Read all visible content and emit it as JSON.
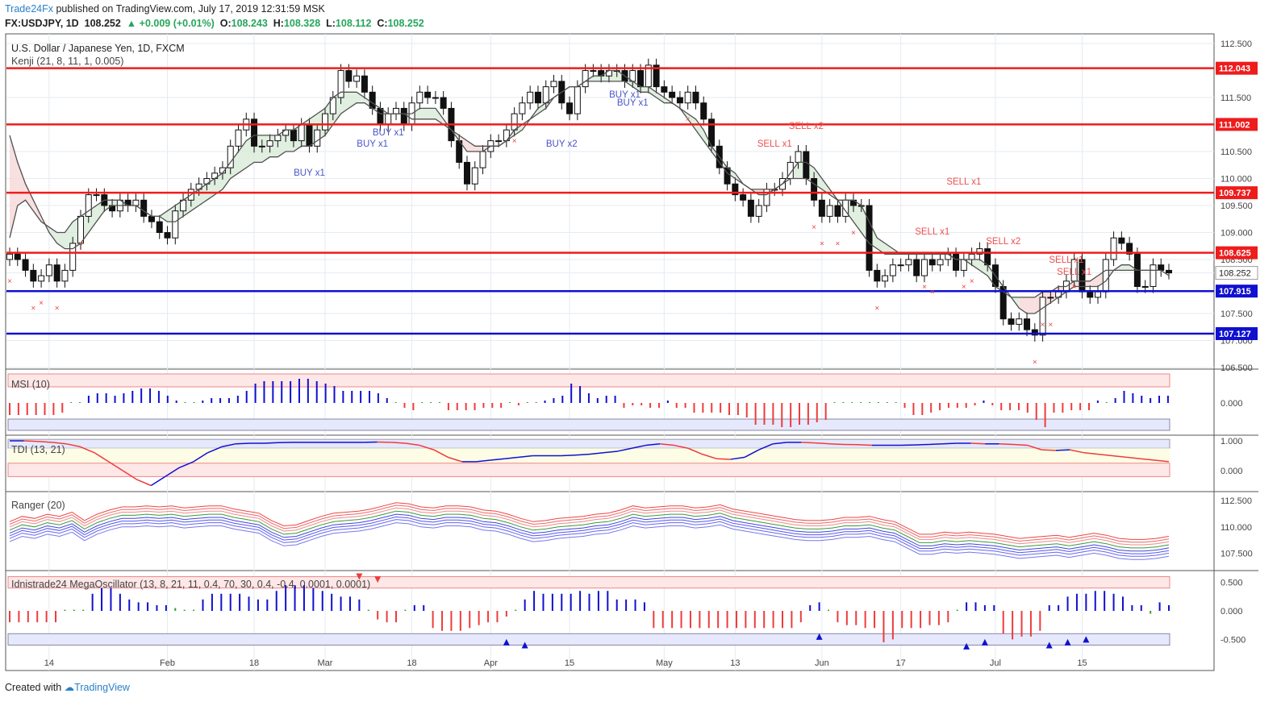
{
  "header": {
    "brand": "Trade24Fx",
    "published": " published on TradingView.com, July 17, 2019 12:31:59 MSK",
    "symbol": "FX:USDJPY, 1D",
    "last": "108.252",
    "change": "+0.009 (+0.01%)",
    "o_label": "O:",
    "o": "108.243",
    "h_label": "H:",
    "h": "108.328",
    "l_label": "L:",
    "l": "108.112",
    "c_label": "C:",
    "c": "108.252"
  },
  "footer": {
    "created": "Created with",
    "logo": "TradingView"
  },
  "colors": {
    "up": "#26a65b",
    "down": "#ef3b3b",
    "support": "#1010d0",
    "resistance": "#ee1c1c",
    "buy": "#4a55c8",
    "sell": "#ee5050",
    "line_green": "#3b9a3b"
  },
  "chart_data": [
    {
      "type": "line",
      "title": "U.S. Dollar / Japanese Yen, 1D, FXCM",
      "indicator": "Kenji (21, 8, 11, 1, 0.005)",
      "x_ticks": [
        "14",
        "Feb",
        "18",
        "Mar",
        "18",
        "Apr",
        "15",
        "May",
        "13",
        "Jun",
        "17",
        "Jul",
        "15"
      ],
      "y_ticks": [
        "112.500",
        "111.500",
        "110.500",
        "110.000",
        "109.500",
        "109.000",
        "108.500",
        "108.252",
        "107.500",
        "107.000",
        "106.500"
      ],
      "ylim": [
        106.5,
        112.65
      ],
      "horizontal_levels": [
        {
          "value": 112.043,
          "label": "112.043",
          "kind": "resistance"
        },
        {
          "value": 111.002,
          "label": "111.002",
          "kind": "resistance"
        },
        {
          "value": 109.737,
          "label": "109.737",
          "kind": "resistance"
        },
        {
          "value": 108.625,
          "label": "108.625",
          "kind": "resistance"
        },
        {
          "value": 107.915,
          "label": "107.915",
          "kind": "support"
        },
        {
          "value": 107.127,
          "label": "107.127",
          "kind": "support"
        }
      ],
      "last_price": {
        "value": 108.252,
        "label": "108.252"
      },
      "close": [
        108.6,
        108.5,
        108.3,
        108.1,
        108.2,
        108.4,
        108.1,
        108.3,
        108.8,
        109.3,
        109.7,
        109.7,
        109.5,
        109.4,
        109.6,
        109.5,
        109.6,
        109.3,
        109.2,
        109.0,
        108.9,
        109.4,
        109.6,
        109.8,
        109.9,
        110.0,
        110.1,
        110.2,
        110.6,
        110.9,
        111.1,
        110.6,
        110.6,
        110.7,
        110.8,
        110.9,
        110.7,
        111.0,
        110.6,
        110.9,
        111.2,
        111.5,
        112.0,
        111.8,
        111.9,
        111.6,
        111.3,
        111.0,
        111.2,
        111.3,
        111.0,
        111.4,
        111.6,
        111.5,
        111.5,
        111.3,
        110.7,
        110.3,
        109.9,
        110.2,
        110.5,
        110.7,
        110.7,
        110.9,
        111.2,
        111.4,
        111.6,
        111.4,
        111.7,
        111.8,
        111.4,
        111.2,
        111.7,
        112.0,
        112.0,
        111.9,
        112.0,
        112.0,
        111.8,
        112.0,
        111.7,
        112.1,
        111.7,
        111.6,
        111.5,
        111.4,
        111.6,
        111.4,
        111.1,
        110.6,
        110.2,
        109.9,
        109.7,
        109.6,
        109.3,
        109.5,
        109.8,
        109.8,
        110.0,
        110.3,
        110.5,
        110.0,
        109.6,
        109.3,
        109.5,
        109.3,
        109.6,
        109.5,
        109.5,
        108.3,
        108.1,
        108.2,
        108.4,
        108.4,
        108.5,
        108.2,
        108.5,
        108.4,
        108.5,
        108.6,
        108.3,
        108.5,
        108.6,
        108.7,
        108.4,
        108.0,
        107.4,
        107.3,
        107.4,
        107.2,
        107.1,
        107.8,
        107.8,
        107.9,
        108.1,
        108.5,
        107.9,
        107.8,
        107.9,
        108.5,
        108.9,
        108.8,
        108.6,
        108.0,
        108.0,
        108.4,
        108.3,
        108.252
      ],
      "series": [
        {
          "kind": "kenji_fast",
          "values": [
            108.9,
            109.5,
            109.6,
            109.4,
            109.2,
            109.1,
            109.0,
            109.0,
            109.2,
            109.3,
            109.4,
            109.5,
            109.6,
            109.6,
            109.6,
            109.5,
            109.5,
            109.4,
            109.3,
            109.3,
            109.4,
            109.5,
            109.6,
            109.7,
            109.8,
            109.9,
            110.0,
            110.1,
            110.3,
            110.5,
            110.7,
            110.8,
            110.8,
            110.8,
            110.8,
            110.9,
            110.9,
            111.0,
            111.1,
            111.2,
            111.3,
            111.5,
            111.6,
            111.6,
            111.6,
            111.5,
            111.4,
            111.3,
            111.2,
            111.2,
            111.2,
            111.2,
            111.3,
            111.3,
            111.3,
            111.1,
            110.9,
            110.7,
            110.5,
            110.5,
            110.5,
            110.6,
            110.6,
            110.7,
            110.9,
            111.0,
            111.1,
            111.3,
            111.4,
            111.5,
            111.6,
            111.7,
            111.7,
            111.8,
            111.9,
            111.9,
            112.0,
            112.0,
            111.9,
            111.8,
            111.7,
            111.7,
            111.6,
            111.5,
            111.4,
            111.3,
            111.2,
            111.1,
            110.9,
            110.6,
            110.4,
            110.2,
            110.1,
            109.9,
            109.8,
            109.7,
            109.7,
            109.8,
            109.9,
            110.1,
            110.3,
            110.3,
            110.2,
            110.0,
            109.8,
            109.6,
            109.6,
            109.6,
            109.5,
            109.2,
            108.9,
            108.8,
            108.7,
            108.6,
            108.6,
            108.6,
            108.6,
            108.6,
            108.6,
            108.6,
            108.5,
            108.5,
            108.5,
            108.5,
            108.4,
            108.2,
            108.0,
            107.8,
            107.6,
            107.5,
            107.5,
            107.6,
            107.7,
            107.8,
            107.9,
            108.0,
            108.0,
            108.0,
            108.0,
            108.1,
            108.3,
            108.4,
            108.4,
            108.3,
            108.3,
            108.3,
            108.3,
            108.2
          ]
        },
        {
          "kind": "kenji_slow",
          "values": [
            110.8,
            110.3,
            109.9,
            109.6,
            109.3,
            109.0,
            108.8,
            108.7,
            108.7,
            108.8,
            109.0,
            109.2,
            109.4,
            109.5,
            109.5,
            109.5,
            109.5,
            109.4,
            109.3,
            109.3,
            109.2,
            109.2,
            109.3,
            109.4,
            109.5,
            109.6,
            109.7,
            109.8,
            110.0,
            110.1,
            110.2,
            110.3,
            110.3,
            110.4,
            110.4,
            110.5,
            110.5,
            110.6,
            110.6,
            110.7,
            110.8,
            111.0,
            111.2,
            111.3,
            111.4,
            111.4,
            111.3,
            111.2,
            111.2,
            111.2,
            111.2,
            111.1,
            111.1,
            111.1,
            111.1,
            111.0,
            110.9,
            110.8,
            110.7,
            110.6,
            110.6,
            110.6,
            110.6,
            110.7,
            110.8,
            110.9,
            111.1,
            111.2,
            111.3,
            111.5,
            111.6,
            111.7,
            111.7,
            111.8,
            111.8,
            111.8,
            111.8,
            111.8,
            111.8,
            111.7,
            111.6,
            111.6,
            111.5,
            111.4,
            111.4,
            111.3,
            111.1,
            110.9,
            110.7,
            110.5,
            110.3,
            110.1,
            110.0,
            109.9,
            109.8,
            109.8,
            109.8,
            109.8,
            109.9,
            110.0,
            110.0,
            110.0,
            109.9,
            109.8,
            109.7,
            109.6,
            109.4,
            109.2,
            109.0,
            108.8,
            108.7,
            108.6,
            108.6,
            108.6,
            108.6,
            108.6,
            108.6,
            108.6,
            108.6,
            108.6,
            108.5,
            108.5,
            108.4,
            108.3,
            108.2,
            108.0,
            107.9,
            107.8,
            107.8,
            107.8,
            107.8,
            107.9,
            107.9,
            108.0,
            108.0,
            108.1,
            108.1,
            108.1,
            108.2,
            108.3,
            108.3,
            108.3,
            108.3,
            108.3,
            108.3,
            108.3
          ]
        }
      ],
      "annotations": [
        "SELL x2",
        "SELL x1",
        "SELL x1",
        "SELL x1",
        "SELL x2",
        "SELL x1",
        "SELL x1",
        "BUY x1",
        "BUY x1",
        "BUY x1",
        "BUY x2",
        "BUY x1",
        "BUY x1"
      ]
    },
    {
      "type": "bar",
      "title": "MSI (10)",
      "y_ticks": [
        "0.000"
      ],
      "values": [
        -0.5,
        -0.5,
        -0.5,
        -0.5,
        -0.5,
        -0.5,
        -0.4,
        0,
        0,
        0.3,
        0.4,
        0.4,
        0.3,
        0.4,
        0.5,
        0.6,
        0.6,
        0.5,
        0.3,
        0.1,
        0,
        0,
        0.1,
        0.2,
        0.2,
        0.2,
        0.3,
        0.5,
        0.8,
        0.9,
        0.9,
        0.9,
        0.9,
        1.0,
        1.0,
        0.9,
        0.8,
        0.7,
        0.5,
        0.5,
        0.5,
        0.5,
        0.4,
        0.2,
        0,
        -0.2,
        -0.3,
        0,
        0,
        0,
        -0.3,
        -0.3,
        -0.3,
        -0.3,
        -0.2,
        -0.2,
        -0.2,
        0,
        -0.1,
        0,
        0,
        0.1,
        0.2,
        0.3,
        0.8,
        0.7,
        0.4,
        0.2,
        0.3,
        0.3,
        -0.2,
        -0.1,
        -0.1,
        -0.2,
        -0.2,
        0.1,
        -0.2,
        -0.2,
        -0.4,
        -0.4,
        -0.4,
        -0.4,
        -0.5,
        -0.5,
        -0.6,
        -0.9,
        -0.9,
        -0.9,
        -1.0,
        -1.0,
        -0.9,
        -0.9,
        -0.8,
        -0.7,
        0,
        0,
        0,
        0,
        0,
        0,
        0,
        0,
        -0.2,
        -0.5,
        -0.5,
        -0.4,
        -0.3,
        -0.2,
        -0.2,
        -0.2,
        -0.1,
        0.1,
        -0.1,
        -0.3,
        -0.3,
        -0.3,
        -0.4,
        -0.7,
        -1.0,
        -0.4,
        -0.4,
        -0.3,
        -0.3,
        -0.3,
        0.1,
        0,
        0.2,
        0.5,
        0.4,
        0.3,
        0.2,
        0.3,
        0.3
      ]
    },
    {
      "type": "line",
      "title": "TDI (13, 21)",
      "y_ticks": [
        "1.000",
        "0.000"
      ],
      "values": [
        1,
        1,
        0.98,
        0.95,
        0.9,
        0.8,
        0.6,
        0.3,
        0,
        -0.3,
        -0.5,
        -0.2,
        0.1,
        0.3,
        0.6,
        0.8,
        0.9,
        0.92,
        0.92,
        0.94,
        0.95,
        0.95,
        0.95,
        0.95,
        0.95,
        0.95,
        0.96,
        0.95,
        0.92,
        0.85,
        0.7,
        0.45,
        0.3,
        0.3,
        0.35,
        0.4,
        0.45,
        0.5,
        0.5,
        0.5,
        0.52,
        0.55,
        0.6,
        0.65,
        0.75,
        0.85,
        0.9,
        0.85,
        0.75,
        0.55,
        0.4,
        0.38,
        0.45,
        0.7,
        0.9,
        0.95,
        0.95,
        0.93,
        0.9,
        0.88,
        0.87,
        0.85,
        0.85,
        0.85,
        0.86,
        0.88,
        0.9,
        0.92,
        0.92,
        0.9,
        0.9,
        0.88,
        0.85,
        0.7,
        0.68,
        0.7,
        0.6,
        0.55,
        0.5,
        0.45,
        0.4,
        0.35,
        0.3
      ]
    },
    {
      "type": "line",
      "title": "Ranger (20)",
      "y_ticks": [
        "112.500",
        "110.000",
        "107.500"
      ],
      "series": [
        {
          "name": "upper_red",
          "values": [
            110.5,
            111.0,
            110.8,
            111.2,
            111.0,
            111.4,
            110.6,
            111.2,
            111.6,
            111.9,
            111.9,
            112.0,
            111.9,
            112.0,
            111.8,
            111.9,
            112.0,
            112.0,
            111.7,
            111.5,
            111.3,
            110.6,
            110.1,
            110.2,
            110.6,
            111.0,
            111.3,
            111.4,
            111.5,
            111.7,
            112.0,
            112.3,
            112.2,
            111.9,
            111.8,
            112.0,
            112.0,
            111.9,
            111.6,
            111.5,
            111.2,
            110.8,
            110.5,
            110.6,
            110.8,
            110.9,
            111.0,
            111.2,
            111.3,
            111.6,
            112.0,
            111.8,
            111.9,
            112.0,
            112.0,
            111.8,
            111.9,
            112.1,
            111.7,
            111.5,
            111.3,
            111.1,
            110.9,
            110.7,
            110.6,
            110.6,
            110.7,
            110.9,
            110.9,
            111.0,
            110.7,
            110.5,
            109.9,
            109.3,
            109.3,
            109.5,
            109.4,
            109.5,
            109.4,
            109.3,
            109.1,
            108.9,
            109.0,
            109.1,
            109.2,
            109.0,
            109.2,
            109.4,
            109.2,
            108.9,
            108.8,
            108.8,
            108.9,
            109.1
          ]
        }
      ]
    },
    {
      "type": "bar",
      "title": "Idnistrade24 MegaOscillator (13, 8, 21, 11, 0.4, 70, 30, 0.4, -0.4, 0.0001, 0.0001)",
      "y_ticks": [
        "0.500",
        "0.000",
        "-0.500"
      ],
      "ylim": [
        -0.65,
        0.65
      ],
      "values": [
        -0.2,
        -0.2,
        -0.2,
        -0.2,
        -0.2,
        -0.2,
        0,
        0,
        0,
        0.3,
        0.4,
        0.4,
        0.3,
        0.2,
        0.15,
        0.15,
        0.1,
        0.1,
        0.05,
        0,
        0,
        0.2,
        0.3,
        0.3,
        0.3,
        0.3,
        0.25,
        0.2,
        0.2,
        0.35,
        0.45,
        0.45,
        0.45,
        0.4,
        0.35,
        0.3,
        0.25,
        0.25,
        0.2,
        0,
        -0.15,
        -0.2,
        -0.2,
        0,
        0.1,
        0.1,
        -0.3,
        -0.35,
        -0.35,
        -0.35,
        -0.3,
        -0.25,
        -0.2,
        -0.2,
        -0.1,
        0,
        0.2,
        0.35,
        0.3,
        0.3,
        0.3,
        0.3,
        0.35,
        0.3,
        0.35,
        0.35,
        0.2,
        0.2,
        0.2,
        0.15,
        -0.3,
        -0.3,
        -0.3,
        -0.3,
        -0.3,
        -0.3,
        -0.3,
        -0.3,
        -0.3,
        -0.3,
        -0.3,
        -0.3,
        -0.3,
        -0.3,
        -0.3,
        -0.3,
        -0.2,
        0.1,
        0.15,
        0,
        -0.2,
        -0.25,
        -0.25,
        -0.3,
        -0.3,
        -0.55,
        -0.5,
        -0.3,
        -0.3,
        -0.3,
        -0.25,
        -0.25,
        -0.2,
        0,
        0.15,
        0.15,
        0.1,
        0.1,
        -0.4,
        -0.5,
        -0.45,
        -0.45,
        -0.35,
        0.1,
        0.1,
        0.25,
        0.3,
        0.3,
        0.35,
        0.35,
        0.3,
        0.25,
        0.1,
        0.1,
        -0.05,
        0.15,
        0.1
      ]
    }
  ]
}
